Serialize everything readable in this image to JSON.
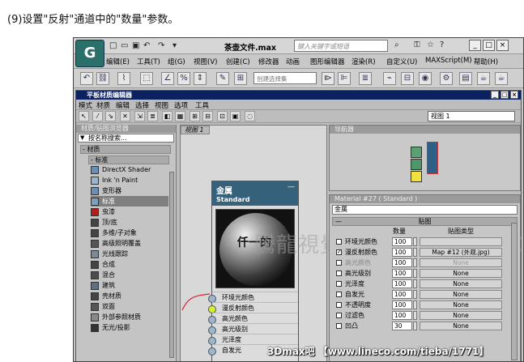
{
  "caption": "(9)设置\"反射\"通道中的\"数量\"参数。",
  "app": {
    "logo_glyph": "G",
    "doc_title": "茶壶文件.max",
    "search_placeholder": "键入关键字或短语",
    "menu": [
      "编辑(E)",
      "工具(T)",
      "组(G)",
      "视图(V)",
      "创建(C)",
      "修改器",
      "动画",
      "图形编辑器",
      "渲染(R)",
      "自定义(U)",
      "MAXScript(M)",
      "帮助(H)"
    ],
    "selection_set_placeholder": "创建选择集"
  },
  "slate": {
    "title": "平板材质编辑器",
    "menu": [
      "模式",
      "材质",
      "编辑",
      "选择",
      "视图",
      "选项",
      "工具"
    ],
    "view_select": "视图 1",
    "browser": {
      "title": "材质/贴图浏览器",
      "search": "按名称搜索...",
      "group": "- 材质",
      "subgroup": "- 标准",
      "materials": [
        {
          "label": "DirectX Shader",
          "color": "#6a8fb4"
        },
        {
          "label": "Ink 'n Paint",
          "color": "#9ab3c8"
        },
        {
          "label": "变形器",
          "color": "#6a8fb4"
        },
        {
          "label": "标准",
          "color": "#7f9fb6",
          "selected": true
        },
        {
          "label": "虫漆",
          "color": "#b0201a"
        },
        {
          "label": "顶/底",
          "color": "#444444"
        },
        {
          "label": "多维/子对象",
          "color": "#444444"
        },
        {
          "label": "高级照明覆盖",
          "color": "#555555"
        },
        {
          "label": "光线跟踪",
          "color": "#7a8a9a"
        },
        {
          "label": "合成",
          "color": "#444444"
        },
        {
          "label": "混合",
          "color": "#4b4b4b"
        },
        {
          "label": "建筑",
          "color": "#607080"
        },
        {
          "label": "壳材质",
          "color": "#444444"
        },
        {
          "label": "双面",
          "color": "#555555"
        },
        {
          "label": "外部参照材质",
          "color": "#888888"
        },
        {
          "label": "无光/投影",
          "color": "#333333"
        }
      ]
    },
    "view_tab": "视图 1",
    "watermark": "騰龍視覺 WWW.TL-VI.NET",
    "node": {
      "title": "金属",
      "subtitle": "Standard",
      "dash": "—",
      "sphere_mark": "仟一的",
      "slots": [
        "环境光颜色",
        "漫反射颜色",
        "高光颜色",
        "高光级别",
        "光泽度",
        "自发光"
      ],
      "hot_slot": 1
    },
    "navigator_title": "导航器",
    "params": {
      "title": "Material #27  ( Standard )",
      "name": "金属",
      "rollout": "贴图",
      "col_amount": "数量",
      "col_map": "贴图类型",
      "rows": [
        {
          "label": "环境光颜色",
          "checked": false,
          "amount": "100",
          "map": "",
          "dim": false,
          "map_dim": true
        },
        {
          "label": "漫反射颜色",
          "checked": true,
          "amount": "100",
          "map": "Map #12 (外观.jpg)",
          "dim": false,
          "map_dim": false
        },
        {
          "label": "高光颜色",
          "checked": false,
          "amount": "100",
          "map": "None",
          "dim": true,
          "map_dim": true
        },
        {
          "label": "高光级别",
          "checked": false,
          "amount": "100",
          "map": "None",
          "dim": false,
          "map_dim": false
        },
        {
          "label": "光泽度",
          "checked": false,
          "amount": "100",
          "map": "None",
          "dim": false,
          "map_dim": false
        },
        {
          "label": "自发光",
          "checked": false,
          "amount": "100",
          "map": "None",
          "dim": false,
          "map_dim": false
        },
        {
          "label": "不透明度",
          "checked": false,
          "amount": "100",
          "map": "None",
          "dim": false,
          "map_dim": false
        },
        {
          "label": "过滤色",
          "checked": false,
          "amount": "100",
          "map": "None",
          "dim": false,
          "map_dim": false
        },
        {
          "label": "凹凸",
          "checked": false,
          "amount": "30",
          "map": "None",
          "dim": false,
          "map_dim": false
        }
      ]
    }
  },
  "footer_watermark": "3Dmax吧 【www.lineco.com/tieba/1771】"
}
